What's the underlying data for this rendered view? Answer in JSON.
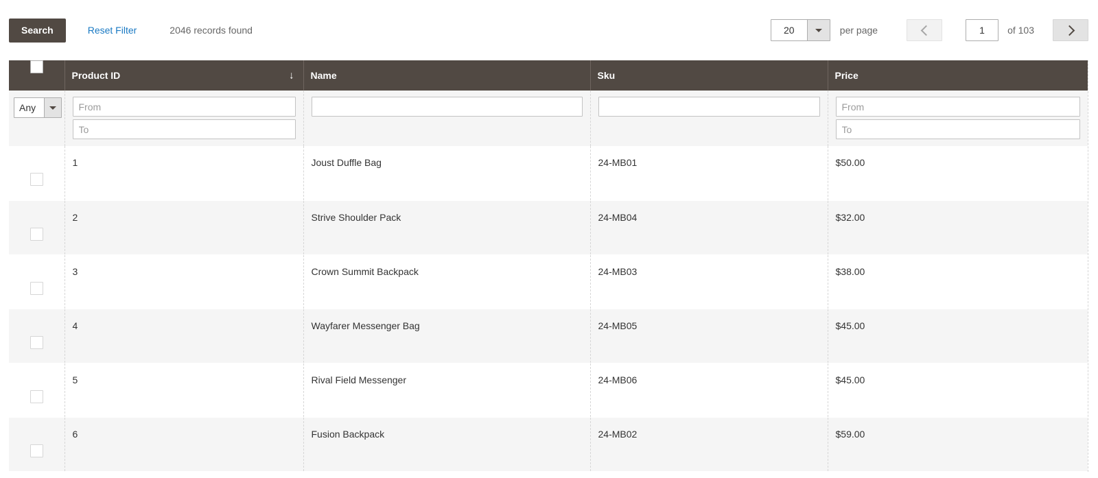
{
  "toolbar": {
    "search_label": "Search",
    "reset_filter_label": "Reset Filter",
    "records_found": "2046 records found",
    "per_page_value": "20",
    "per_page_label": "per page",
    "prev_icon": "chevron-left-icon",
    "next_icon": "chevron-right-icon",
    "page_value": "1",
    "of_total": "of 103"
  },
  "grid": {
    "columns": [
      {
        "key": "check",
        "label": ""
      },
      {
        "key": "id",
        "label": "Product ID",
        "sort_icon": "arrow-down-icon",
        "sort_glyph": "↓"
      },
      {
        "key": "name",
        "label": "Name"
      },
      {
        "key": "sku",
        "label": "Sku"
      },
      {
        "key": "price",
        "label": "Price"
      }
    ],
    "filters": {
      "any_label": "Any",
      "id_from_placeholder": "From",
      "id_to_placeholder": "To",
      "name_placeholder": "",
      "sku_placeholder": "",
      "price_from_placeholder": "From",
      "price_to_placeholder": "To",
      "id_from_value": "",
      "id_to_value": "",
      "name_value": "",
      "sku_value": "",
      "price_from_value": "",
      "price_to_value": ""
    },
    "rows": [
      {
        "id": "1",
        "name": "Joust Duffle Bag",
        "sku": "24-MB01",
        "price": "$50.00"
      },
      {
        "id": "2",
        "name": "Strive Shoulder Pack",
        "sku": "24-MB04",
        "price": "$32.00"
      },
      {
        "id": "3",
        "name": "Crown Summit Backpack",
        "sku": "24-MB03",
        "price": "$38.00"
      },
      {
        "id": "4",
        "name": "Wayfarer Messenger Bag",
        "sku": "24-MB05",
        "price": "$45.00"
      },
      {
        "id": "5",
        "name": "Rival Field Messenger",
        "sku": "24-MB06",
        "price": "$45.00"
      },
      {
        "id": "6",
        "name": "Fusion Backpack",
        "sku": "24-MB02",
        "price": "$59.00"
      }
    ]
  },
  "colors": {
    "header_bg": "#514943",
    "link": "#1979c3",
    "row_alt_bg": "#f5f5f5",
    "text": "#333333",
    "muted": "#666666"
  }
}
